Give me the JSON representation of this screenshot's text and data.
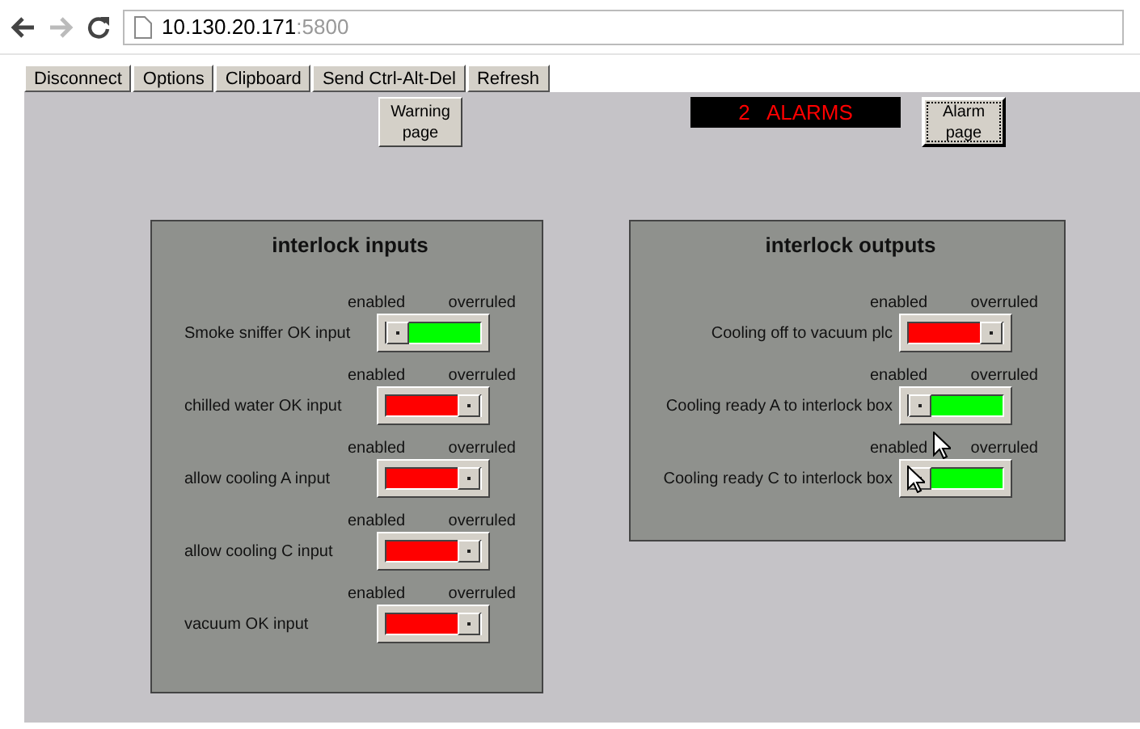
{
  "browser": {
    "address_host": "10.130.20.171",
    "address_port": ":5800"
  },
  "toolbar": [
    "Disconnect",
    "Options",
    "Clipboard",
    "Send Ctrl-Alt-Del",
    "Refresh"
  ],
  "header": {
    "warning_button": "Warning page",
    "alarm_display": "2   ALARMS",
    "alarm_button": "Alarm page"
  },
  "panels": [
    {
      "title": "interlock inputs",
      "rows": [
        {
          "label": "Smoke sniffer OK input",
          "left_label": "enabled",
          "right_label": "overruled",
          "overruled": false
        },
        {
          "label": "chilled water OK input",
          "left_label": "enabled",
          "right_label": "overruled",
          "overruled": true
        },
        {
          "label": "allow cooling A input",
          "left_label": "enabled",
          "right_label": "overruled",
          "overruled": true
        },
        {
          "label": "allow cooling C input",
          "left_label": "enabled",
          "right_label": "overruled",
          "overruled": true
        },
        {
          "label": "vacuum OK input",
          "left_label": "enabled",
          "right_label": "overruled",
          "overruled": true
        }
      ]
    },
    {
      "title": "interlock outputs",
      "rows": [
        {
          "label": "Cooling off to vacuum plc",
          "left_label": "enabled",
          "right_label": "overruled",
          "overruled": true
        },
        {
          "label": "Cooling ready A to interlock box",
          "left_label": "enabled",
          "right_label": "overruled",
          "overruled": false
        },
        {
          "label": "Cooling ready C to interlock box",
          "left_label": "enabled",
          "right_label": "overruled",
          "overruled": false
        }
      ]
    }
  ]
}
